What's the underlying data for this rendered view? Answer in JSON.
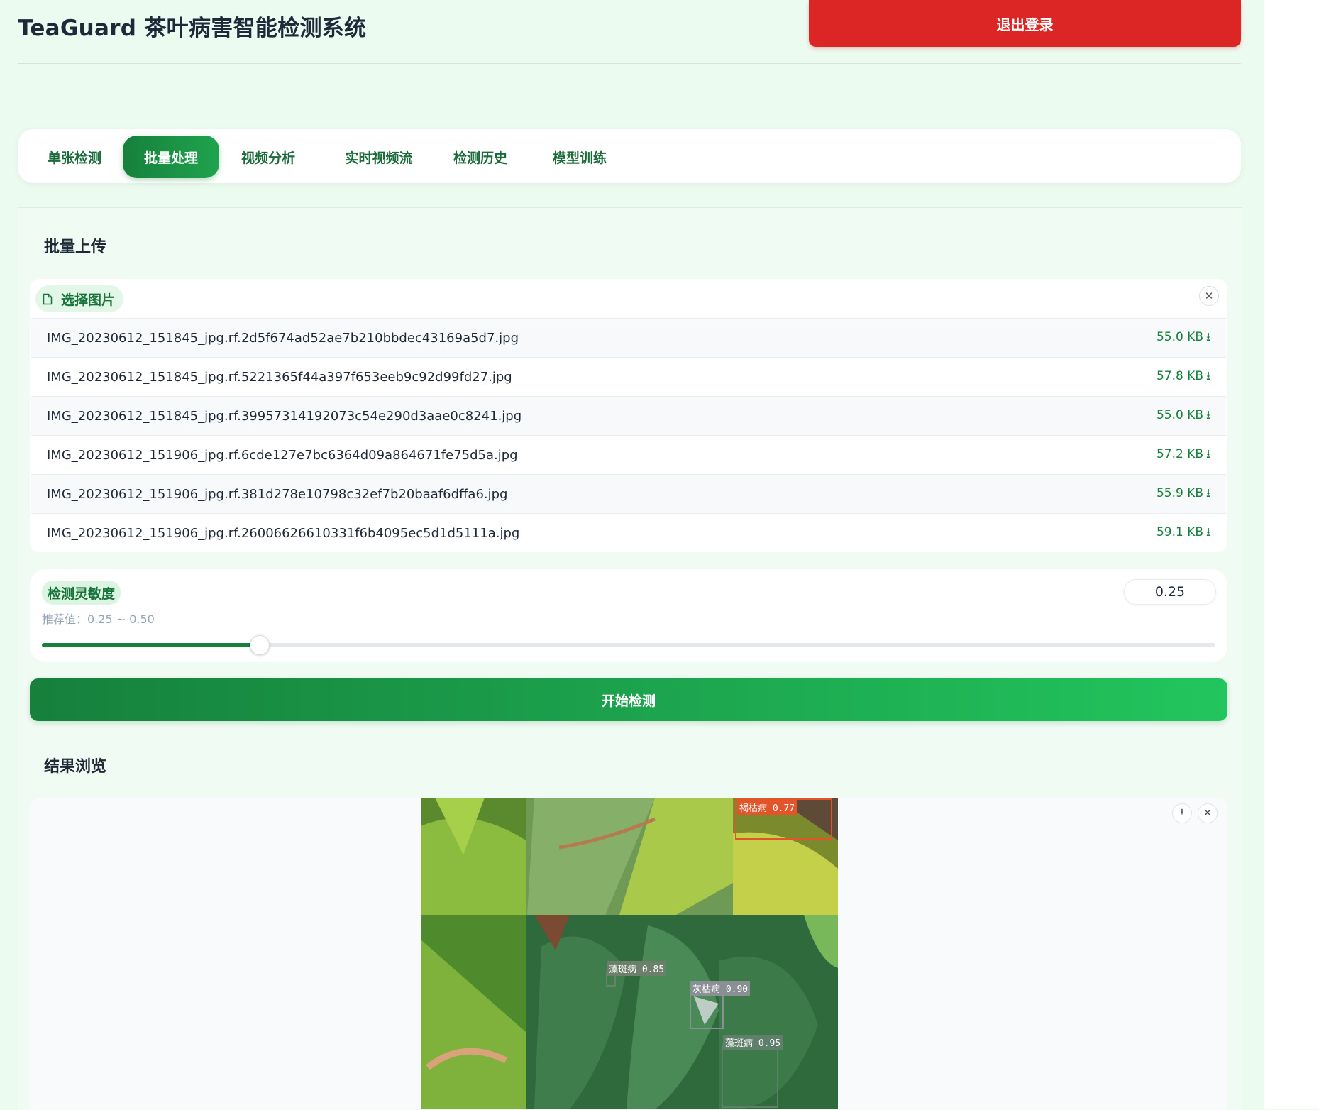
{
  "header": {
    "title": "TeaGuard 茶叶病害智能检测系统",
    "logout_label": "退出登录"
  },
  "tabs": [
    {
      "label": "单张检测"
    },
    {
      "label": "批量处理"
    },
    {
      "label": "视频分析"
    },
    {
      "label": "实时视频流"
    },
    {
      "label": "检测历史"
    },
    {
      "label": "模型训练"
    }
  ],
  "active_tab": "批量处理",
  "upload": {
    "section_title": "批量上传",
    "choose_label": "选择图片",
    "clear_icon": "close-icon",
    "files": [
      {
        "name": "IMG_20230612_151845_jpg.rf.2d5f674ad52ae7b210bbdec43169a5d7.jpg",
        "size": "55.0 KB"
      },
      {
        "name": "IMG_20230612_151845_jpg.rf.5221365f44a397f653eeb9c92d99fd27.jpg",
        "size": "57.8 KB"
      },
      {
        "name": "IMG_20230612_151845_jpg.rf.39957314192073c54e290d3aae0c8241.jpg",
        "size": "55.0 KB"
      },
      {
        "name": "IMG_20230612_151906_jpg.rf.6cde127e7bc6364d09a864671fe75d5a.jpg",
        "size": "57.2 KB"
      },
      {
        "name": "IMG_20230612_151906_jpg.rf.381d278e10798c32ef7b20baaf6dffa6.jpg",
        "size": "55.9 KB"
      },
      {
        "name": "IMG_20230612_151906_jpg.rf.26006626610331f6b4095ec5d1d5111a.jpg",
        "size": "59.1 KB"
      }
    ]
  },
  "sensitivity": {
    "label": "检测灵敏度",
    "hint": "推荐值：0.25 ~ 0.50",
    "value": "0.25",
    "slider_fraction": 0.185
  },
  "start_label": "开始检测",
  "results": {
    "section_title": "结果浏览",
    "detections": [
      {
        "label": "褐枯病 0.77",
        "color": "#e2552a"
      },
      {
        "label": "藻斑病 0.85",
        "color": "#6b7f6b"
      },
      {
        "label": "灰枯病 0.90",
        "color": "#8a8f94"
      },
      {
        "label": "藻斑病 0.95",
        "color": "#5f7f6a"
      }
    ]
  },
  "colors": {
    "accent": "#16803c",
    "danger": "#dc2626",
    "background": "#ecfbf0"
  }
}
